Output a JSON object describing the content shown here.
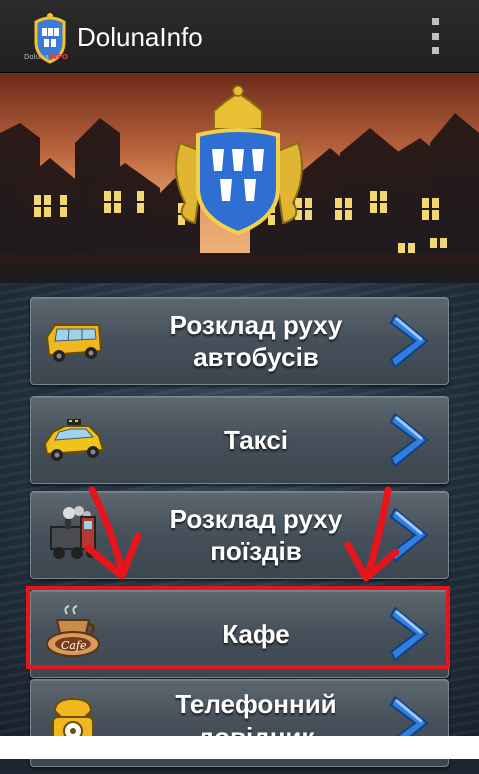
{
  "app": {
    "title": "DolunaInfo",
    "logo_caption_a": "Doluna",
    "logo_caption_b": "INFO"
  },
  "menu": [
    {
      "line1": "Розклад руху",
      "line2": "автобусів",
      "icon": "bus-icon"
    },
    {
      "line1": "Таксі",
      "line2": "",
      "icon": "taxi-icon"
    },
    {
      "line1": "Розклад руху",
      "line2": "поїздів",
      "icon": "train-icon"
    },
    {
      "line1": "Кафе",
      "line2": "",
      "icon": "cafe-icon"
    },
    {
      "line1": "Телефонний",
      "line2": "довідник",
      "icon": "phone-directory-icon"
    }
  ],
  "colors": {
    "highlight": "#e8141c",
    "chevron": "#2f7fe0",
    "action_bar": "#222222"
  }
}
